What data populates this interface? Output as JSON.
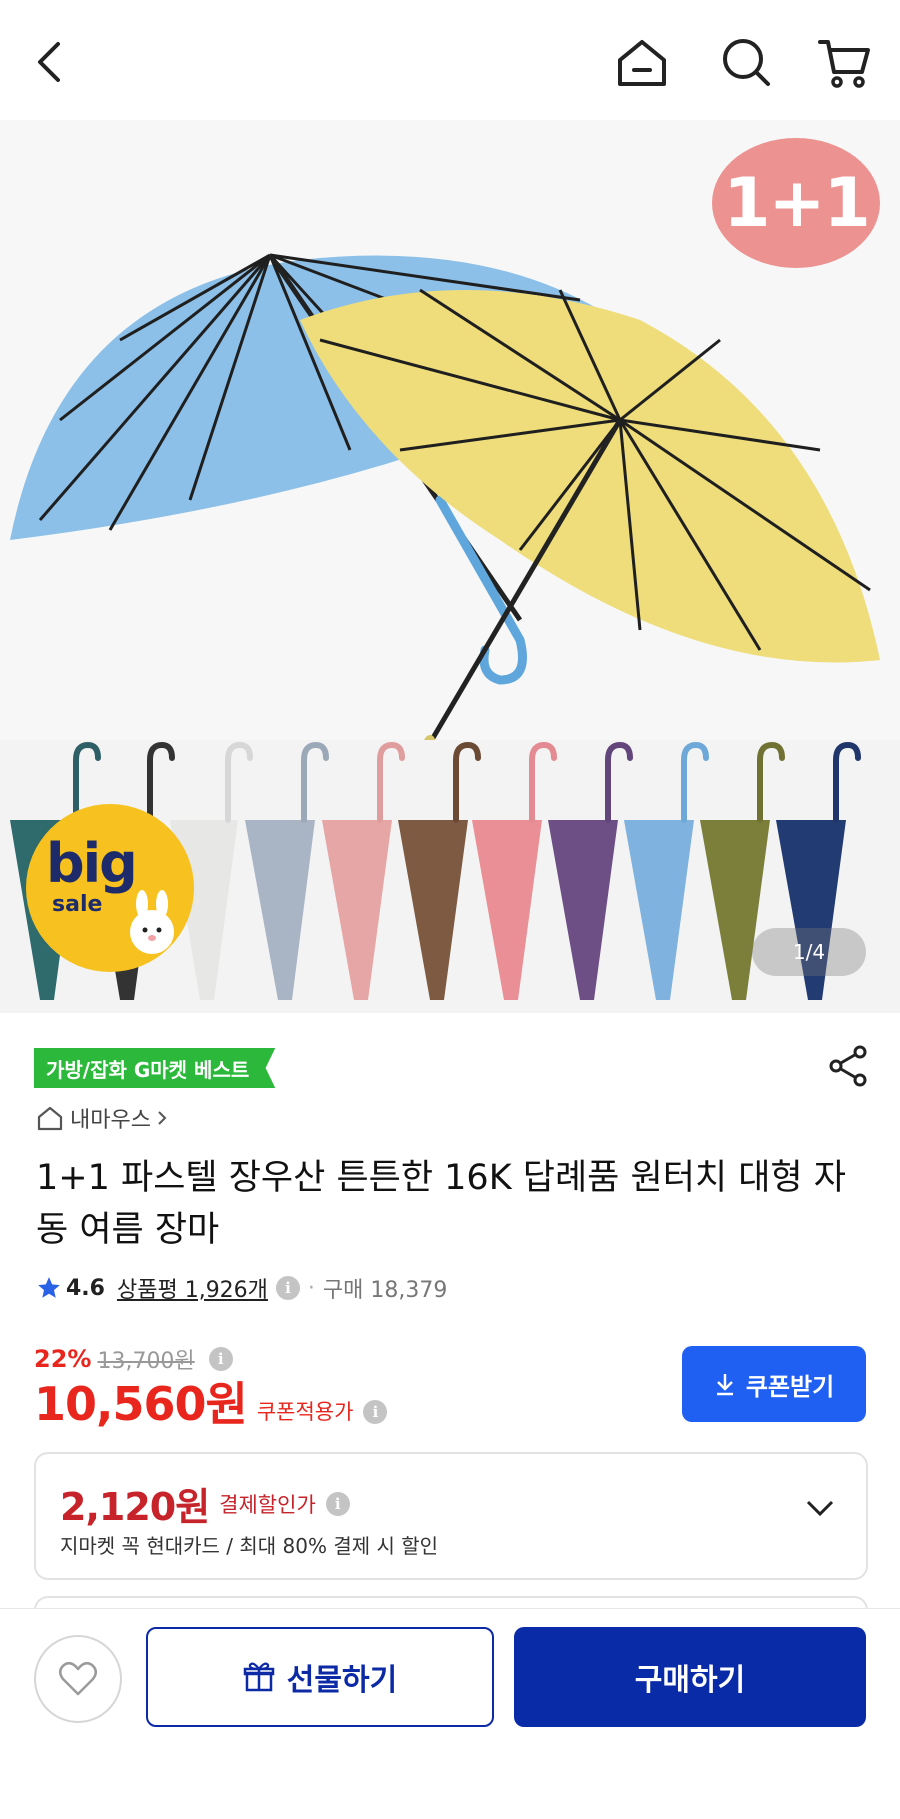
{
  "hero": {
    "promo_badge": "1+1",
    "sale_badge_big": "big",
    "sale_badge_sale": "sale",
    "pager": "1/4"
  },
  "product": {
    "category_badge": "가방/잡화 G마켓 베스트",
    "seller": "내마우스",
    "title": "1+1 파스텔 장우산 튼튼한 16K 답례품 원터치 대형 자동 여름 장마",
    "rating": "4.6",
    "reviews_label": "상품평 1,926개",
    "sales_label": "구매 18,379",
    "discount_pct": "22%",
    "original_price": "13,700원",
    "price": "10,560원",
    "price_note": "쿠폰적용가",
    "coupon_button": "쿠폰받기"
  },
  "card_discount": {
    "amount": "2,120원",
    "label": "결제할인가",
    "description": "지마켓 꼭 현대카드 / 최대 80% 결제 시 할인"
  },
  "bottom": {
    "gift_button": "선물하기",
    "buy_button": "구매하기"
  },
  "colors": {
    "price_red": "#e8261d",
    "coupon_blue": "#1f5ff2",
    "buy_navy": "#0a2ba8",
    "badge_green": "#2cb93b"
  }
}
